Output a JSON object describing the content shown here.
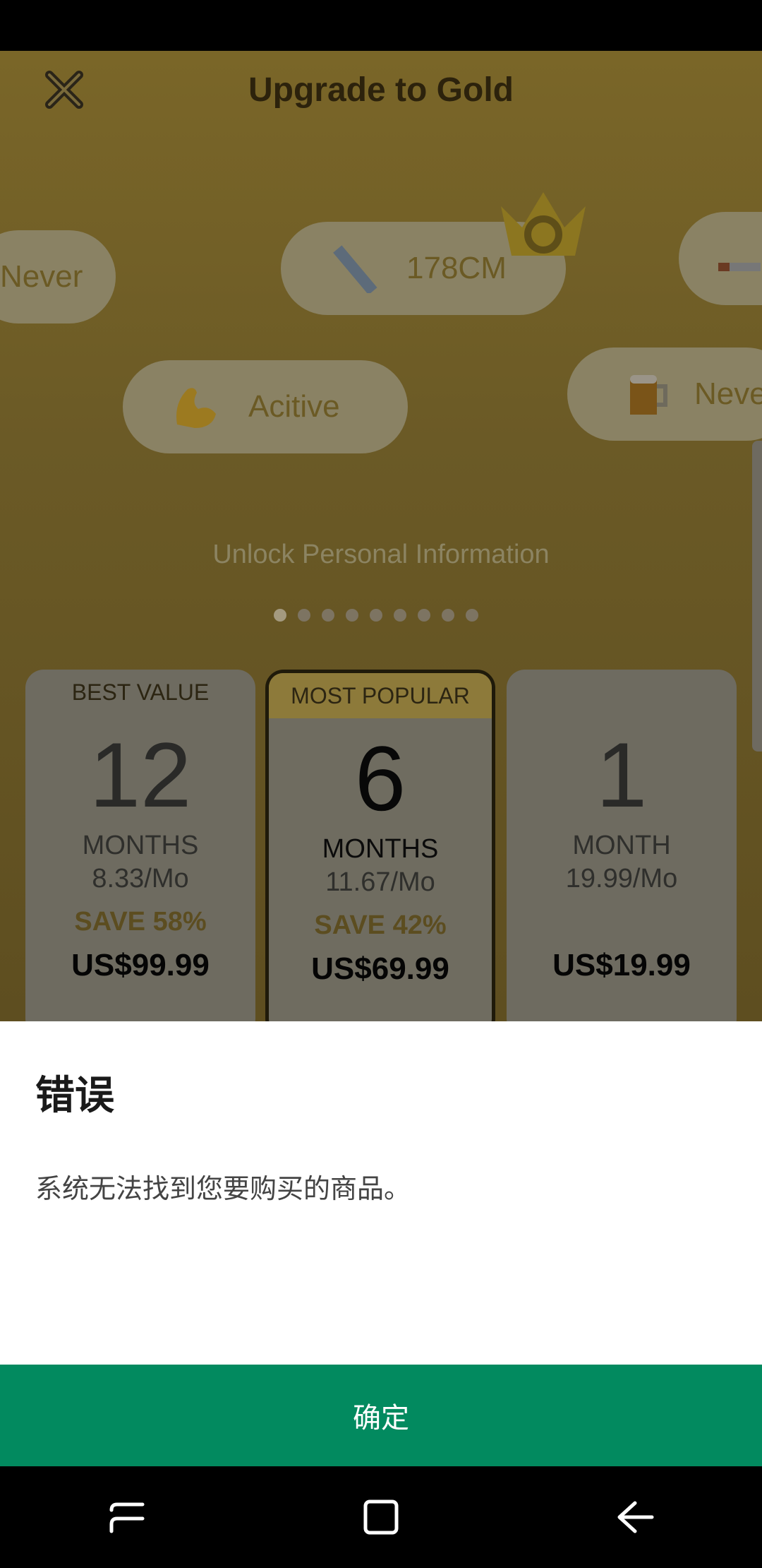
{
  "header": {
    "title": "Upgrade to Gold"
  },
  "pills": [
    {
      "label": "Never",
      "icon": ""
    },
    {
      "label": "178CM",
      "icon": "ruler-icon"
    },
    {
      "label": "",
      "icon": "cigarette-icon"
    },
    {
      "label": "Acitive",
      "icon": "flexed-arm-icon"
    },
    {
      "label": "Neve",
      "icon": "beer-mug-icon"
    }
  ],
  "carousel": {
    "caption": "Unlock Personal Information",
    "dot_count": 9,
    "active_index": 0
  },
  "plans": [
    {
      "badge": "BEST VALUE",
      "number": "12",
      "unit": "MONTHS",
      "per_month": "8.33/Mo",
      "save": "SAVE 58%",
      "price": "US$99.99"
    },
    {
      "badge": "MOST POPULAR",
      "number": "6",
      "unit": "MONTHS",
      "per_month": "11.67/Mo",
      "save": "SAVE 42%",
      "price": "US$69.99"
    },
    {
      "badge": "",
      "number": "1",
      "unit": "MONTH",
      "per_month": "19.99/Mo",
      "save": "",
      "price": "US$19.99"
    }
  ],
  "dialog": {
    "title": "错误",
    "message": "系统无法找到您要购买的商品。",
    "confirm_label": "确定",
    "confirm_color": "#028a5f"
  },
  "navbar": {
    "icons": [
      "recents-icon",
      "home-icon",
      "back-icon"
    ]
  }
}
